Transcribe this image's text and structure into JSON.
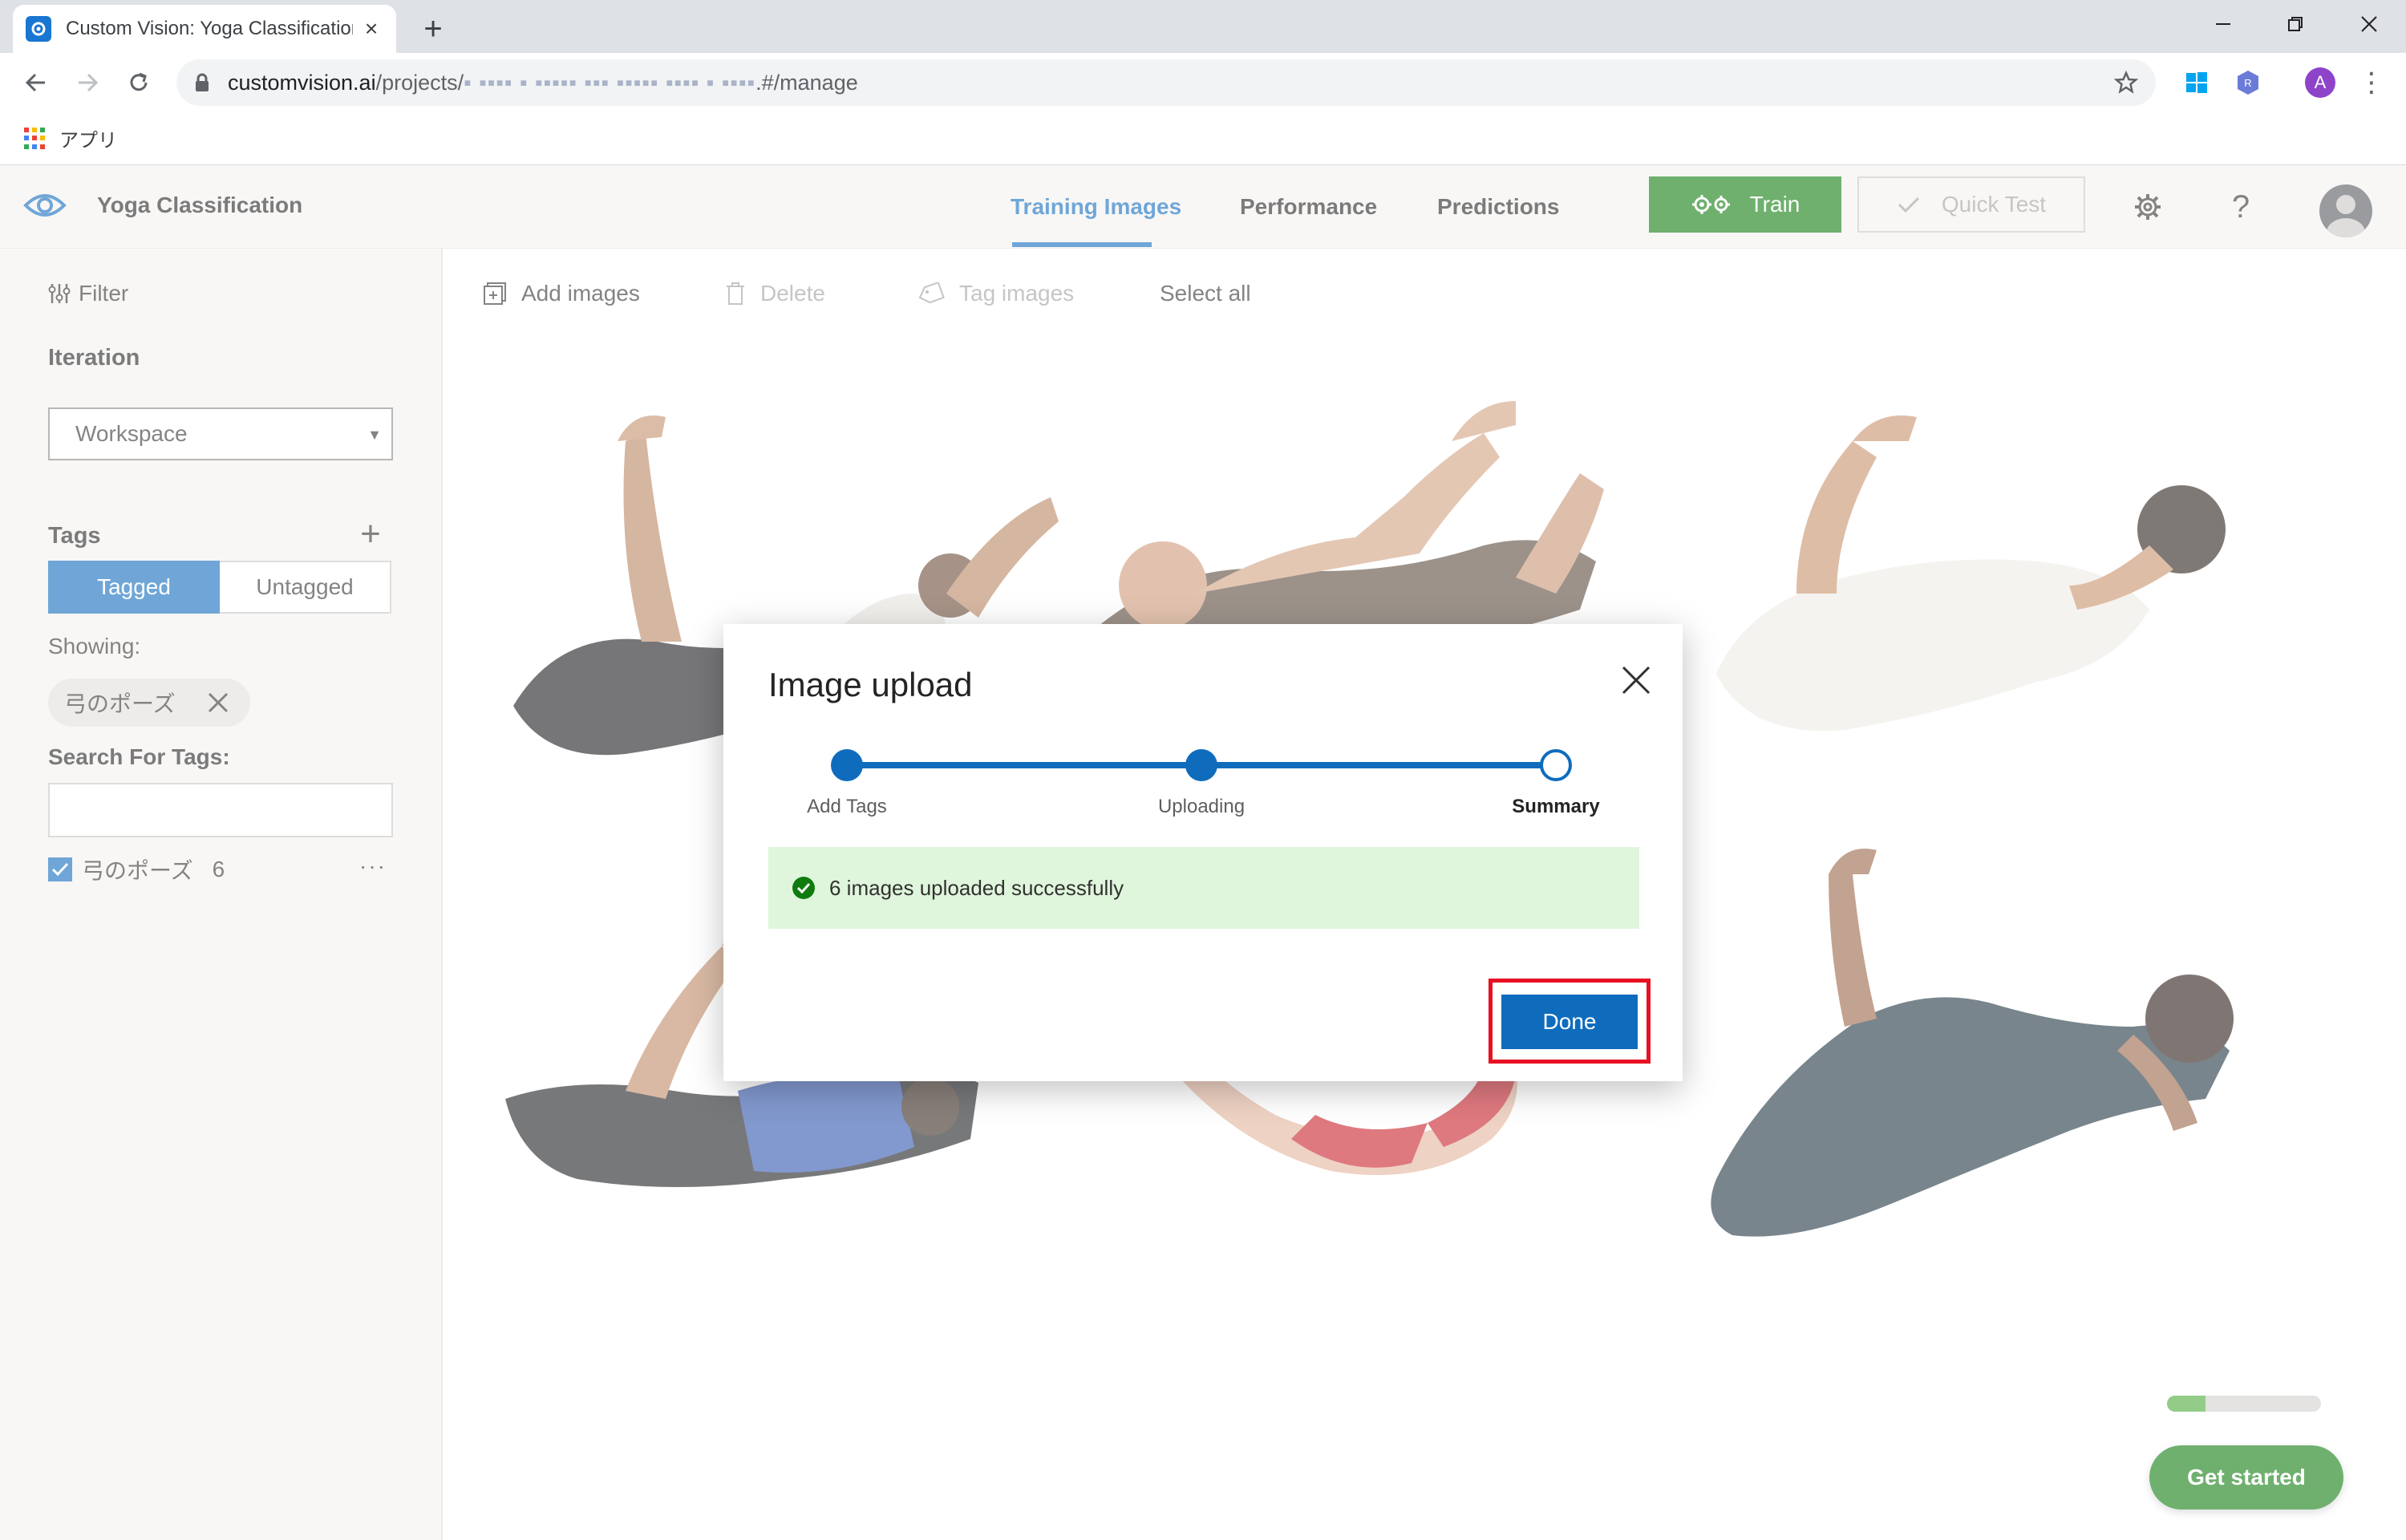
{
  "browser": {
    "tab_title": "Custom Vision: Yoga Classification",
    "url_host": "customvision.ai",
    "url_path_prefix": "/projects/",
    "url_obscured": "▪︎ ▪▪▪▪ ▪ ▪▪▪▪▪ ▪▪▪ ▪▪▪▪▪ ▪▪▪▪ ▪ ▪▪▪▪",
    "url_path_suffix": ".#/manage",
    "bookmark_label": "アプリ",
    "profile_initial": "A"
  },
  "app": {
    "title": "Yoga Classification",
    "nav_tabs": [
      {
        "label": "Training Images",
        "active": true
      },
      {
        "label": "Performance",
        "active": false
      },
      {
        "label": "Predictions",
        "active": false
      }
    ],
    "train_label": "Train",
    "quick_test_label": "Quick Test",
    "help_label": "?"
  },
  "sidebar": {
    "filter_label": "Filter",
    "iteration_heading": "Iteration",
    "iteration_value": "Workspace",
    "tags_heading": "Tags",
    "tagged_label": "Tagged",
    "untagged_label": "Untagged",
    "showing_label": "Showing:",
    "chip_label": "弓のポーズ",
    "search_label": "Search For Tags:",
    "search_value": "",
    "tag_name": "弓のポーズ",
    "tag_count": "6",
    "tag_more": "···"
  },
  "commands": {
    "add_images": "Add images",
    "delete": "Delete",
    "tag_images": "Tag images",
    "select_all": "Select all"
  },
  "modal": {
    "title": "Image upload",
    "steps": [
      "Add Tags",
      "Uploading",
      "Summary"
    ],
    "success_message": "6 images uploaded successfully",
    "done_label": "Done"
  },
  "progress": {
    "value": 0.25
  },
  "get_started_label": "Get started",
  "colors": {
    "accent": "#0f6cbd",
    "train_green": "#107c10",
    "success_bg": "#dff6dd",
    "highlight_red": "#e81123"
  }
}
